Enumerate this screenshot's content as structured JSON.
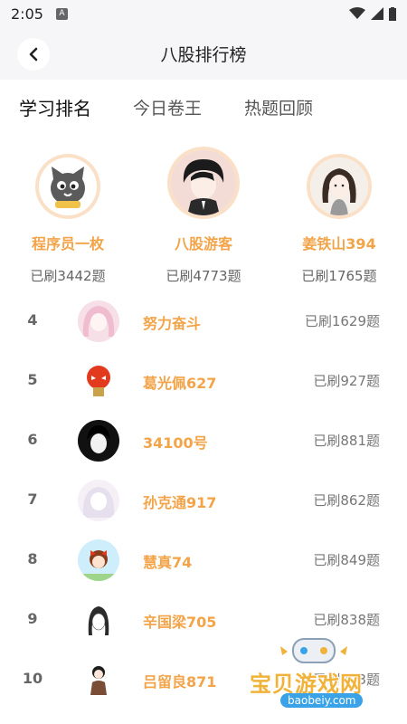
{
  "status": {
    "time": "2:05",
    "notification": "A"
  },
  "header": {
    "title": "八股排行榜"
  },
  "tabs": [
    {
      "label": "学习排名",
      "active": true
    },
    {
      "label": "今日卷王",
      "active": false
    },
    {
      "label": "热题回顾",
      "active": false
    }
  ],
  "podium": [
    {
      "rank": 2,
      "name": "程序员一枚",
      "count": "已刷3442题"
    },
    {
      "rank": 1,
      "name": "八股游客",
      "count": "已刷4773题"
    },
    {
      "rank": 3,
      "name": "姜铁山394",
      "count": "已刷1765题"
    }
  ],
  "ranking": [
    {
      "rank": "4",
      "name": "努力奋斗",
      "count": "已刷1629题"
    },
    {
      "rank": "5",
      "name": "葛光佩627",
      "count": "已刷927题"
    },
    {
      "rank": "6",
      "name": "34100号",
      "count": "已刷881题"
    },
    {
      "rank": "7",
      "name": "孙克通917",
      "count": "已刷862题"
    },
    {
      "rank": "8",
      "name": "慧真74",
      "count": "已刷849题"
    },
    {
      "rank": "9",
      "name": "辛国梁705",
      "count": "已刷838题"
    },
    {
      "rank": "10",
      "name": "吕留良871",
      "count": "已刷823题"
    }
  ],
  "watermark": {
    "text": "宝贝游戏网",
    "url": "baobeiy.com"
  },
  "colors": {
    "accent": "#f3a449",
    "ring": "#fbe0c8",
    "header_bg": "#f6f6f8"
  }
}
